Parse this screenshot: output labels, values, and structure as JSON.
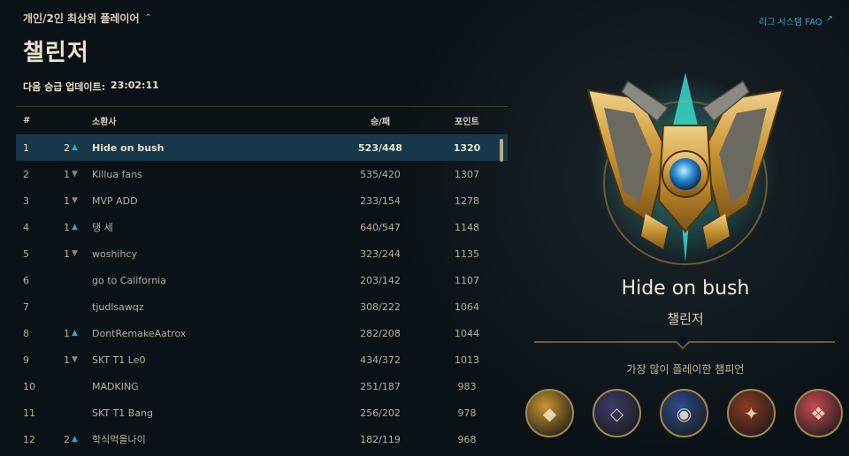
{
  "header": {
    "queue_label": "개인/2인 최상위 플레이어",
    "queue_chevron": "⌃",
    "tier_title": "챌린저",
    "update_label": "다음 승급 업데이트:",
    "update_time": "23:02:11",
    "faq_label": "리그 시스템 FAQ",
    "faq_icon": "↗"
  },
  "table": {
    "columns": {
      "rank": "#",
      "name": "소환사",
      "wl": "승/패",
      "points": "포인트"
    },
    "rows": [
      {
        "rank": "1",
        "change": "2",
        "dir": "up",
        "name": "Hide on bush",
        "wl": "523/448",
        "points": "1320"
      },
      {
        "rank": "2",
        "change": "1",
        "dir": "down",
        "name": "Killua fans",
        "wl": "535/420",
        "points": "1307"
      },
      {
        "rank": "3",
        "change": "1",
        "dir": "down",
        "name": "MVP ADD",
        "wl": "233/154",
        "points": "1278"
      },
      {
        "rank": "4",
        "change": "1",
        "dir": "up",
        "name": "댕 세",
        "wl": "640/547",
        "points": "1148"
      },
      {
        "rank": "5",
        "change": "1",
        "dir": "down",
        "name": "woshihcy",
        "wl": "323/244",
        "points": "1135"
      },
      {
        "rank": "6",
        "change": "",
        "dir": "",
        "name": "go to California",
        "wl": "203/142",
        "points": "1107"
      },
      {
        "rank": "7",
        "change": "",
        "dir": "",
        "name": "tjudlsawqz",
        "wl": "308/222",
        "points": "1064"
      },
      {
        "rank": "8",
        "change": "1",
        "dir": "up",
        "name": "DontRemakeAatrox",
        "wl": "282/208",
        "points": "1044"
      },
      {
        "rank": "9",
        "change": "1",
        "dir": "down",
        "name": "SKT T1 Le0",
        "wl": "434/372",
        "points": "1013"
      },
      {
        "rank": "10",
        "change": "",
        "dir": "",
        "name": "MADKING",
        "wl": "251/187",
        "points": "983"
      },
      {
        "rank": "11",
        "change": "",
        "dir": "",
        "name": "SKT T1 Bang",
        "wl": "256/202",
        "points": "978"
      },
      {
        "rank": "12",
        "change": "2",
        "dir": "up",
        "name": "학식먹을나이",
        "wl": "182/119",
        "points": "968"
      }
    ]
  },
  "profile": {
    "name": "Hide on bush",
    "tier": "챌린저",
    "most_played_label": "가장 많이 플레이한 챔피언"
  },
  "champions": [
    {
      "icon": "champion-portrait-1-icon",
      "color": "#c9962e"
    },
    {
      "icon": "champion-portrait-2-icon",
      "color": "#3a3c6a"
    },
    {
      "icon": "champion-portrait-3-icon",
      "color": "#2d4a8a"
    },
    {
      "icon": "champion-portrait-4-icon",
      "color": "#8a3a22"
    },
    {
      "icon": "champion-portrait-5-icon",
      "color": "#c84a52"
    }
  ],
  "colors": {
    "accent": "#2ea8c8",
    "gold": "#c8a050",
    "selected_row": "#17374a"
  }
}
